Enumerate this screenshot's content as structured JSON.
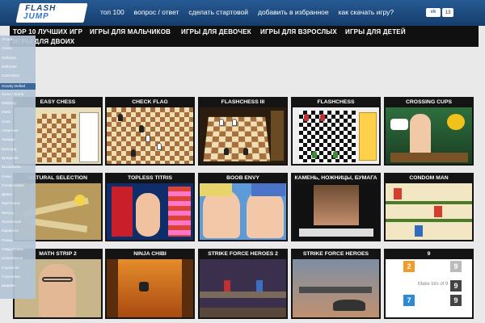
{
  "header": {
    "logo_line1": "FLASH",
    "logo_line2": "JUMP",
    "nav": [
      "топ 100",
      "вопрос / ответ",
      "сделать стартовой",
      "добавить в избранное",
      "как скачать игру?"
    ],
    "vk_label": "vk",
    "vk_count": "13"
  },
  "categories": [
    "ТОР 10 ЛУЧШИХ ИГР",
    "ИГРЫ ДЛЯ МАЛЬЧИКОВ",
    "ИГРЫ ДЛЯ ДЕВОЧЕК",
    "ИГРЫ ДЛЯ ВЗРОСЛЫХ",
    "ИГРЫ ДЛЯ ДЕТЕЙ",
    "ИГРЫ ДЛЯ ДВОИХ"
  ],
  "left_menu": [
    "Arcade",
    "Action",
    "Sokoban",
    "Defender",
    "Gold Miner",
    "Gravity Defied",
    "Zuma / Zuma",
    "Mahjong",
    "Mario",
    "Sonic",
    "Азартные",
    "Аркады",
    "Бильярд",
    "Бродилки",
    "Вышибалы",
    "Гонки",
    "Головоломки",
    "Драки",
    "Карточные",
    "Квесты",
    "Логические",
    "Одевалки",
    "Пазлы",
    "Симуляторы",
    "Спортивные",
    "Стратегии",
    "Стрелялки",
    "Шарики"
  ],
  "games": [
    {
      "title": "EASY CHESS"
    },
    {
      "title": "CHECK FLAG"
    },
    {
      "title": "FLASHCHESS III"
    },
    {
      "title": "FLASHCHESS"
    },
    {
      "title": "CROSSING CUPS"
    },
    {
      "title": "NATURAL SELECTION"
    },
    {
      "title": "TOPLESS TITRIS"
    },
    {
      "title": "BOOB ENVY"
    },
    {
      "title": "КАМЕНЬ, НОЖНИЦЫ, БУМАГА"
    },
    {
      "title": "CONDOM MAN"
    },
    {
      "title": "MATH STRIP 2"
    },
    {
      "title": "NINJA CHIBI"
    },
    {
      "title": "STRIKE FORCE HEROES 2"
    },
    {
      "title": "STRIKE FORCE HEROES"
    },
    {
      "title": "9"
    }
  ],
  "thumb_text": {
    "checkflag_level": "Level 6",
    "checkflag_select": "Level Select",
    "nine_caption": "Make lots of 9",
    "nine_cells": [
      "2",
      "9",
      "9",
      "7",
      "9"
    ]
  }
}
